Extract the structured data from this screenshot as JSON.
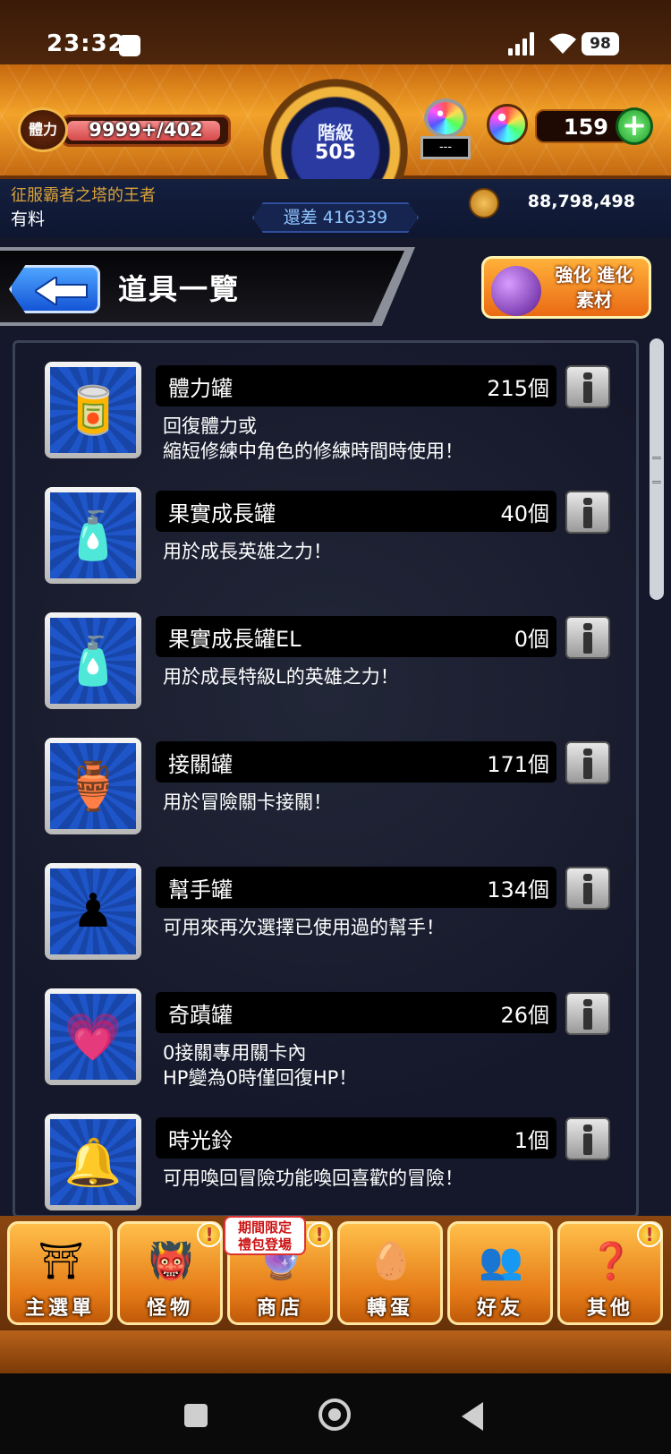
{
  "status_bar": {
    "time": "23:32",
    "battery": "98",
    "icons": [
      "notification-icon",
      "signal-icon",
      "wifi-icon",
      "battery-icon"
    ]
  },
  "header": {
    "stamina_label": "體力",
    "stamina_value": "9999+/402",
    "stamina_fill": 0.97,
    "rank_label": "階級",
    "rank_value": "505",
    "rank_remaining": "還差 416339",
    "orb_slot_text": "---",
    "gems": "159",
    "plus_label": "+",
    "player_title": "征服霸者之塔的王者",
    "player_name": "有料",
    "coins": "88,798,498"
  },
  "page": {
    "title": "道具一覽",
    "evolve_button": "強化 進化\n素材"
  },
  "items": [
    {
      "name": "體力罐",
      "count": "215個",
      "desc": "回復體力或\n縮短修練中角色的修練時間時使用！",
      "icon": "stamina-can-icon",
      "glyph": "🥫"
    },
    {
      "name": "果實成長罐",
      "count": "40個",
      "desc": "用於成長英雄之力！",
      "icon": "fruit-growth-bottle-icon",
      "glyph": "🧴"
    },
    {
      "name": "果實成長罐EL",
      "count": "0個",
      "desc": "用於成長特級L的英雄之力！",
      "icon": "fruit-growth-bottle-el-icon",
      "glyph": "🧴"
    },
    {
      "name": "接關罐",
      "count": "171個",
      "desc": "用於冒險關卡接關！",
      "icon": "continue-jar-icon",
      "glyph": "🏺"
    },
    {
      "name": "幫手罐",
      "count": "134個",
      "desc": "可用來再次選擇已使用過的幫手！",
      "icon": "helper-jar-icon",
      "glyph": "♟"
    },
    {
      "name": "奇蹟罐",
      "count": "26個",
      "desc": "0接關專用關卡內\nHP變為0時僅回復HP！",
      "icon": "miracle-jar-icon",
      "glyph": "💗"
    },
    {
      "name": "時光鈴",
      "count": "1個",
      "desc": "可用喚回冒險功能喚回喜歡的冒險！",
      "icon": "time-bell-icon",
      "glyph": "🔔"
    }
  ],
  "nav": [
    {
      "label": "主選單",
      "icon": "home-gate-icon",
      "glyph": "⛩",
      "alert": false
    },
    {
      "label": "怪物",
      "icon": "monster-icon",
      "glyph": "👹",
      "alert": true
    },
    {
      "label": "商店",
      "icon": "shop-orb-icon",
      "glyph": "🔮",
      "alert": true
    },
    {
      "label": "轉蛋",
      "icon": "gacha-egg-icon",
      "glyph": "🥚",
      "alert": false
    },
    {
      "label": "好友",
      "icon": "friends-icon",
      "glyph": "👥",
      "alert": false
    },
    {
      "label": "其他",
      "icon": "other-menu-icon",
      "glyph": "❓",
      "alert": true
    }
  ],
  "shop_badge": "期間限定\n禮包登場",
  "alert_mark": "!"
}
